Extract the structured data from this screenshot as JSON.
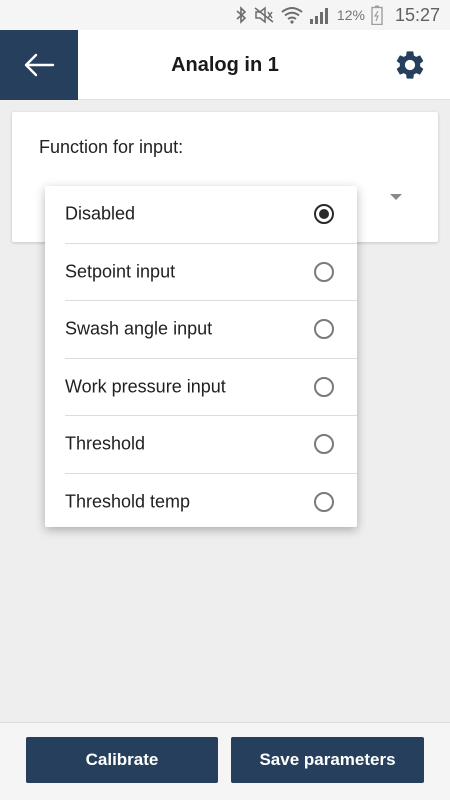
{
  "status_bar": {
    "battery_percent": "12%",
    "time": "15:27",
    "icons": [
      "bluetooth-icon",
      "mute-icon",
      "wifi-icon",
      "signal-icon",
      "battery-icon"
    ]
  },
  "app_bar": {
    "title": "Analog in 1",
    "back_icon": "arrow-left-icon",
    "settings_icon": "gear-icon",
    "accent_color": "#253f5c"
  },
  "card": {
    "label": "Function for input:"
  },
  "options": [
    {
      "label": "Disabled",
      "selected": true
    },
    {
      "label": "Setpoint input",
      "selected": false
    },
    {
      "label": "Swash angle input",
      "selected": false
    },
    {
      "label": "Work pressure input",
      "selected": false
    },
    {
      "label": "Threshold",
      "selected": false
    },
    {
      "label": "Threshold temp",
      "selected": false
    }
  ],
  "buttons": {
    "calibrate": "Calibrate",
    "save": "Save parameters"
  }
}
